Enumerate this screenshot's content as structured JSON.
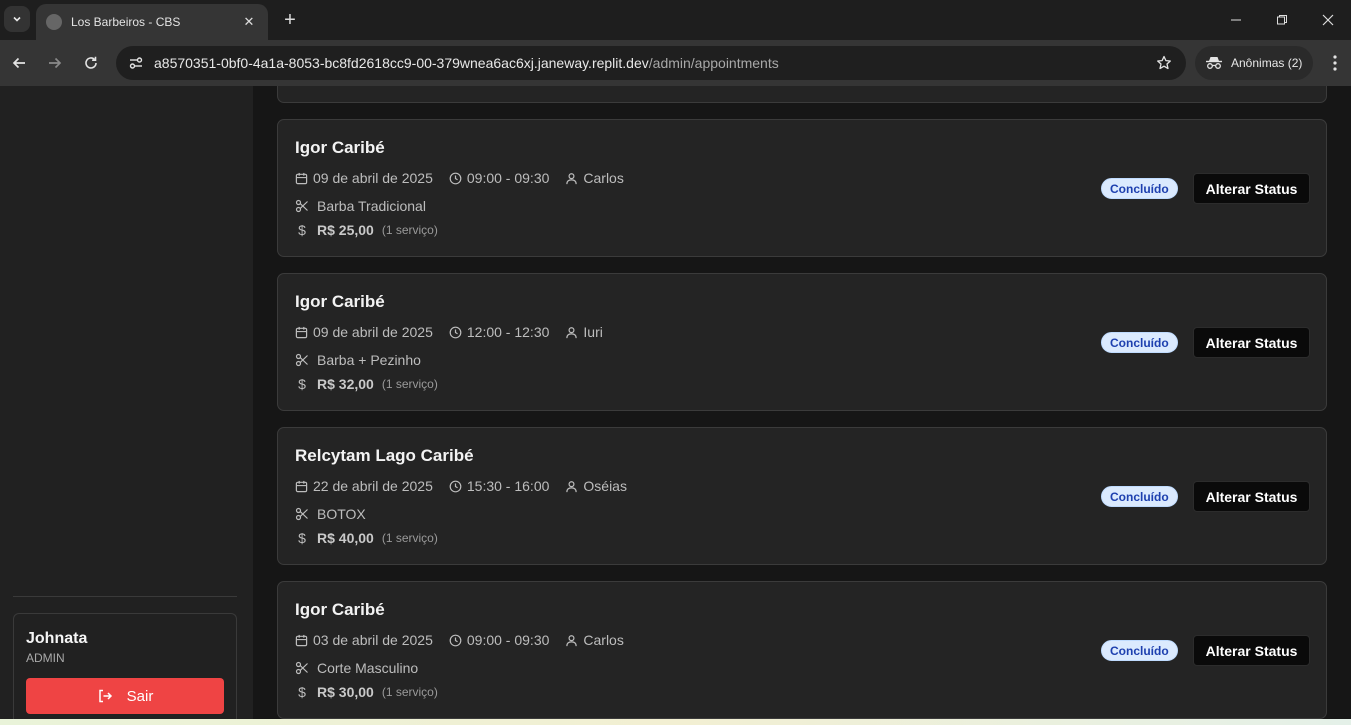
{
  "browser": {
    "tab_title": "Los Barbeiros - CBS",
    "url_host": "a8570351-0bf0-4a1a-8053-bc8fd2618cc9-00-379wnea6ac6xj.janeway.replit.dev",
    "url_path": "/admin/appointments",
    "incognito_label": "Anônimas (2)"
  },
  "sidebar": {
    "user_name": "Johnata",
    "user_role": "ADMIN",
    "logout_label": "Sair"
  },
  "appointments": [
    {
      "client": "Igor Caribé",
      "date": "09 de abril de 2025",
      "time": "09:00 - 09:30",
      "barber": "Carlos",
      "service": "Barba Tradicional",
      "price": "R$ 25,00",
      "count": "(1 serviço)",
      "status": "Concluído",
      "action": "Alterar Status"
    },
    {
      "client": "Igor Caribé",
      "date": "09 de abril de 2025",
      "time": "12:00 - 12:30",
      "barber": "Iuri",
      "service": "Barba + Pezinho",
      "price": "R$ 32,00",
      "count": "(1 serviço)",
      "status": "Concluído",
      "action": "Alterar Status"
    },
    {
      "client": "Relcytam Lago Caribé",
      "date": "22 de abril de 2025",
      "time": "15:30 - 16:00",
      "barber": "Oséias",
      "service": "BOTOX",
      "price": "R$ 40,00",
      "count": "(1 serviço)",
      "status": "Concluído",
      "action": "Alterar Status"
    },
    {
      "client": "Igor Caribé",
      "date": "03 de abril de 2025",
      "time": "09:00 - 09:30",
      "barber": "Carlos",
      "service": "Corte Masculino",
      "price": "R$ 30,00",
      "count": "(1 serviço)",
      "status": "Concluído",
      "action": "Alterar Status"
    }
  ],
  "colors": {
    "logout_red": "#ef4444",
    "badge_bg": "#dbeafe",
    "badge_text": "#1e40af"
  }
}
